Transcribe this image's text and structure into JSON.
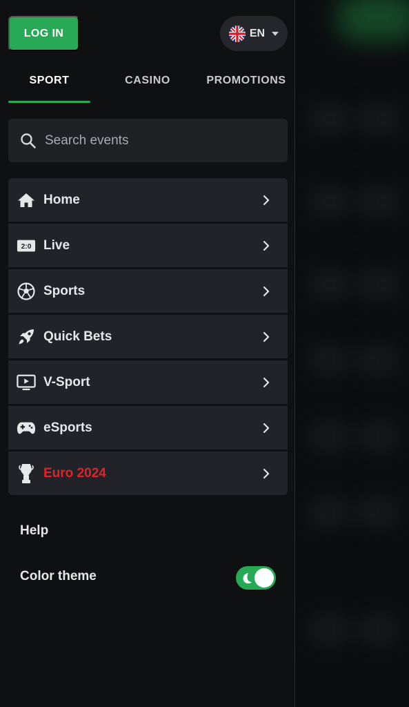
{
  "header": {
    "login_label": "LOG IN",
    "language_code": "EN",
    "language_flag_icon": "uk-flag-icon"
  },
  "tabs": [
    {
      "label": "SPORT",
      "active": true
    },
    {
      "label": "CASINO",
      "active": false
    },
    {
      "label": "PROMOTIONS",
      "active": false
    }
  ],
  "search": {
    "placeholder": "Search events",
    "icon": "search-icon"
  },
  "menu": {
    "items": [
      {
        "label": "Home",
        "icon": "home-icon"
      },
      {
        "label": "Live",
        "icon": "live-score-icon",
        "icon_text": "2:0"
      },
      {
        "label": "Sports",
        "icon": "soccer-ball-icon"
      },
      {
        "label": "Quick Bets",
        "icon": "rocket-icon"
      },
      {
        "label": "V-Sport",
        "icon": "tv-icon"
      },
      {
        "label": "eSports",
        "icon": "gamepad-icon"
      },
      {
        "label": "Euro 2024",
        "icon": "trophy-icon",
        "highlight": true
      }
    ]
  },
  "footer": {
    "help_label": "Help",
    "color_theme_label": "Color theme",
    "dark_mode_enabled": true
  },
  "colors": {
    "accent": "#27a955",
    "highlight": "#e0232b",
    "background": "#0f1012",
    "panel": "#212328"
  }
}
